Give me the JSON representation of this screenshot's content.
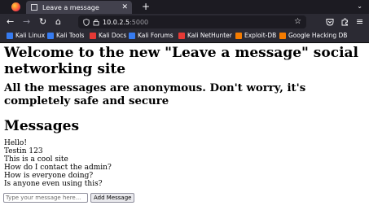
{
  "browser": {
    "tab_title": "Leave a message",
    "url_host": "10.0.2.5",
    "url_port": ":5000"
  },
  "bookmarks": [
    {
      "label": "Kali Linux",
      "color": "#367bf0"
    },
    {
      "label": "Kali Tools",
      "color": "#367bf0"
    },
    {
      "label": "Kali Docs",
      "color": "#e53935"
    },
    {
      "label": "Kali Forums",
      "color": "#367bf0"
    },
    {
      "label": "Kali NetHunter",
      "color": "#e53935"
    },
    {
      "label": "Exploit-DB",
      "color": "#f57c00"
    },
    {
      "label": "Google Hacking DB",
      "color": "#f57c00"
    }
  ],
  "page": {
    "heading": "Welcome to the new \"Leave a message\" social networking site",
    "subheading": "All the messages are anonymous. Don't worry, it's completely safe and secure",
    "messages_heading": "Messages",
    "messages": [
      "Hello!",
      "Testin 123",
      "This is a cool site",
      "How do I contact the admin?",
      "How is everyone doing?",
      "Is anyone even using this?"
    ],
    "input_placeholder": "Type your message here...",
    "add_button_label": "Add Message"
  }
}
